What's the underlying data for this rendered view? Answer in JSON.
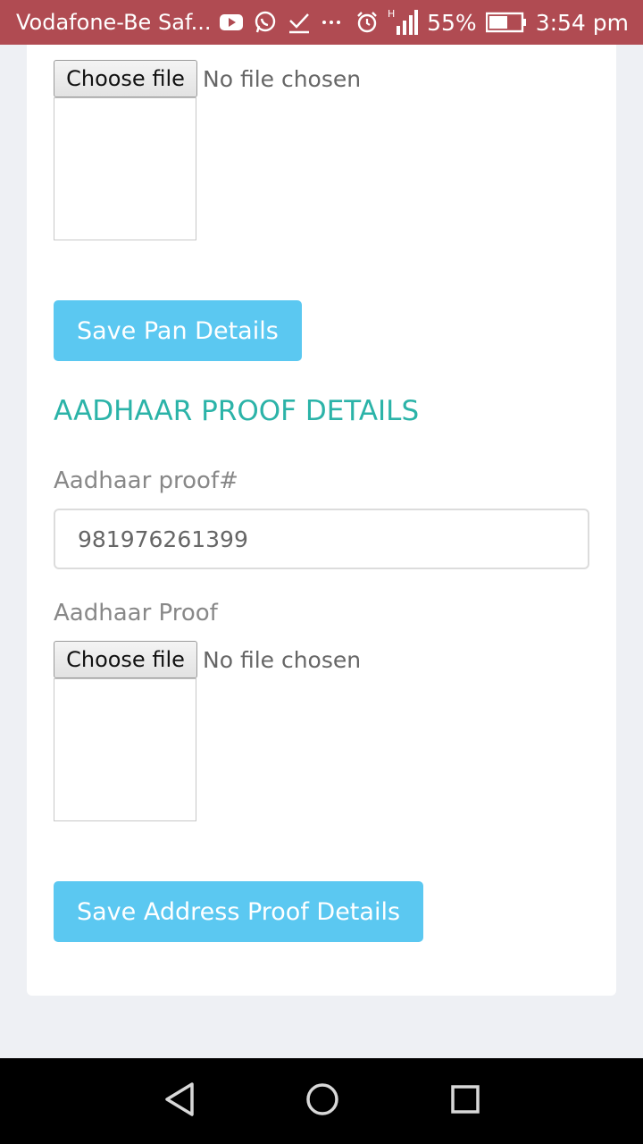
{
  "status_bar": {
    "carrier": "Vodafone-Be Saf...",
    "battery": "55%",
    "time": "3:54 pm",
    "icons": [
      "youtube-icon",
      "whatsapp-icon",
      "checkmark-icon",
      "more-icon",
      "alarm-icon",
      "signal-icon",
      "battery-icon"
    ]
  },
  "pan_section": {
    "file_button_label": "Choose file",
    "file_status": "No file chosen",
    "save_button_label": "Save Pan Details"
  },
  "aadhaar_section": {
    "heading": "AADHAAR PROOF DETAILS",
    "number_label": "Aadhaar proof#",
    "number_value": "981976261399",
    "proof_label": "Aadhaar Proof",
    "file_button_label": "Choose file",
    "file_status": "No file chosen",
    "save_button_label": "Save Address Proof Details"
  },
  "nav_bar": {
    "icons": [
      "back-icon",
      "home-icon",
      "recents-icon"
    ]
  },
  "colors": {
    "status_bar": "#b04b52",
    "accent_button": "#5bc8f1",
    "heading": "#2bb3a8",
    "page_bg": "#eef0f4"
  }
}
